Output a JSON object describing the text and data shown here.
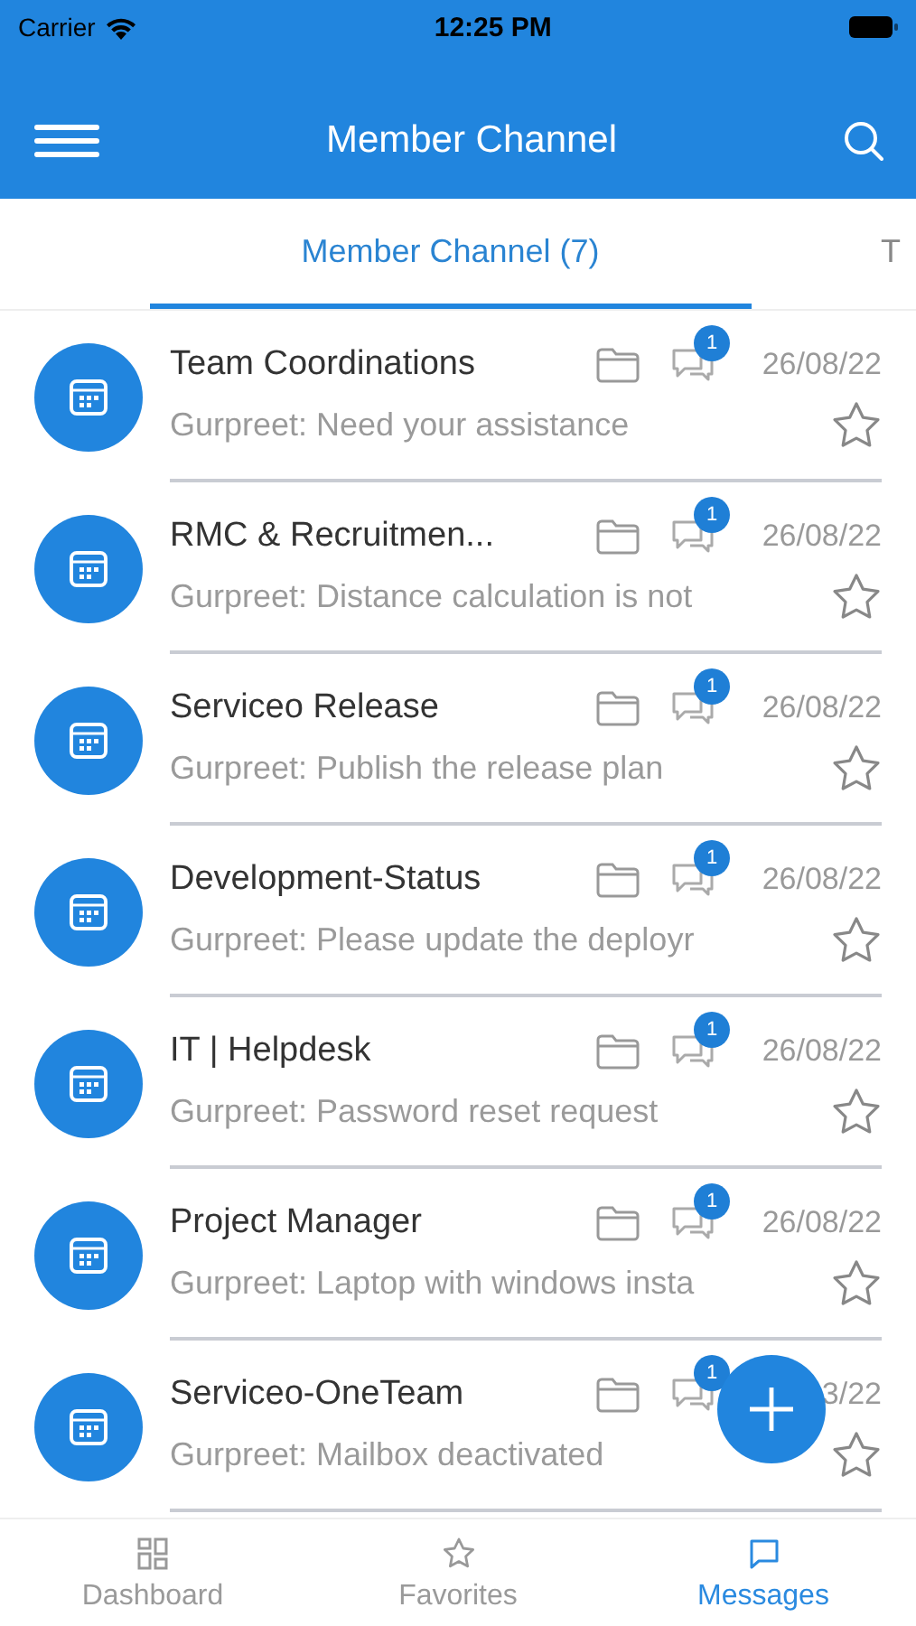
{
  "status_bar": {
    "carrier": "Carrier",
    "time": "12:25 PM"
  },
  "header": {
    "title": "Member Channel"
  },
  "tabs": [
    {
      "label": "Member Channel (7)",
      "selected": true
    },
    {
      "label": "T",
      "selected": false
    }
  ],
  "channels": [
    {
      "name": "Team Coordinations",
      "preview": "Gurpreet: Need your assistance",
      "unread": "1",
      "date": "26/08/22",
      "starred": false
    },
    {
      "name": "RMC & Recruitmen...",
      "preview": "Gurpreet: Distance calculation is not",
      "unread": "1",
      "date": "26/08/22",
      "starred": false
    },
    {
      "name": "Serviceo Release",
      "preview": "Gurpreet: Publish the release plan",
      "unread": "1",
      "date": "26/08/22",
      "starred": false
    },
    {
      "name": "Development-Status",
      "preview": "Gurpreet: Please update the deployr",
      "unread": "1",
      "date": "26/08/22",
      "starred": false
    },
    {
      "name": "IT | Helpdesk",
      "preview": "Gurpreet: Password reset request",
      "unread": "1",
      "date": "26/08/22",
      "starred": false
    },
    {
      "name": "Project Manager",
      "preview": "Gurpreet: Laptop with windows insta",
      "unread": "1",
      "date": "26/08/22",
      "starred": false
    },
    {
      "name": "Serviceo-OneTeam",
      "preview": "Gurpreet: Mailbox deactivated",
      "unread": "1",
      "date": "3/22",
      "starred": false
    }
  ],
  "bottom_nav": [
    {
      "label": "Dashboard",
      "kind": "dashboard",
      "selected": false
    },
    {
      "label": "Favorites",
      "kind": "favorites",
      "selected": false
    },
    {
      "label": "Messages",
      "kind": "messages",
      "selected": true
    }
  ]
}
